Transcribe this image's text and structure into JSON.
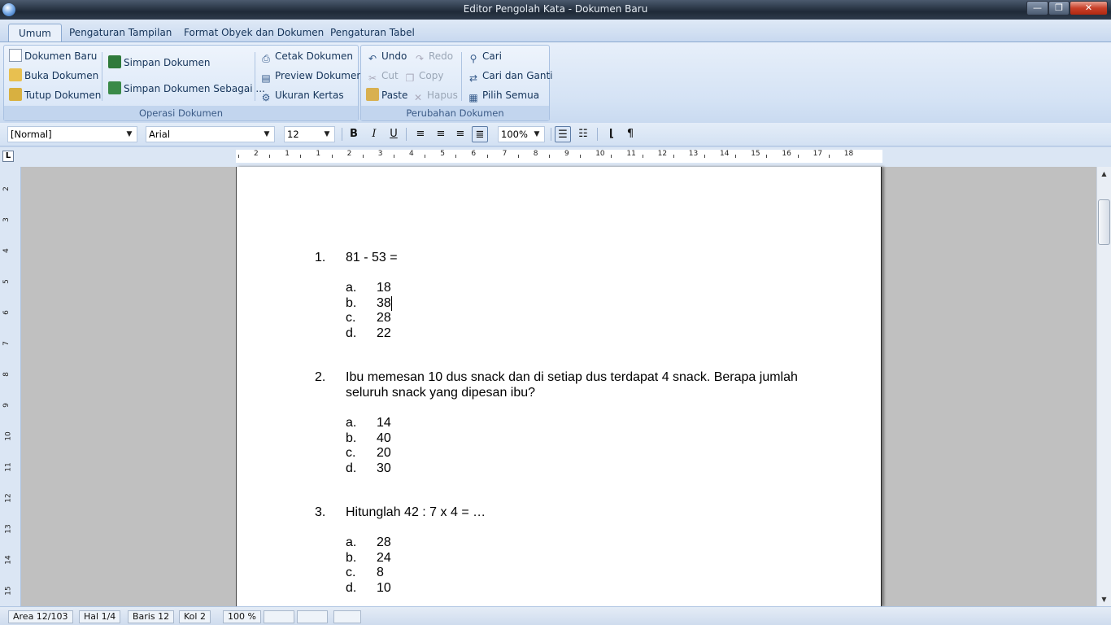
{
  "window": {
    "title": "Editor Pengolah Kata - Dokumen Baru",
    "min": "—",
    "max": "❐",
    "close": "✕"
  },
  "tabs": [
    "Umum",
    "Pengaturan Tampilan",
    "Format Obyek dan Dokumen",
    "Pengaturan Tabel"
  ],
  "ribbon": {
    "operasi": {
      "label": "Operasi Dokumen",
      "dokumen_baru": "Dokumen Baru",
      "buka": "Buka Dokumen",
      "tutup": "Tutup Dokumen",
      "simpan": "Simpan Dokumen",
      "simpan_sebagai": "Simpan Dokumen Sebagai ...",
      "cetak": "Cetak Dokumen",
      "preview": "Preview Dokumen",
      "ukuran": "Ukuran Kertas"
    },
    "perubahan": {
      "label": "Perubahan Dokumen",
      "undo": "Undo",
      "redo": "Redo",
      "cut": "Cut",
      "copy": "Copy",
      "paste": "Paste",
      "hapus": "Hapus",
      "cari": "Cari",
      "cari_ganti": "Cari dan Ganti",
      "pilih_semua": "Pilih Semua"
    }
  },
  "format": {
    "style": "[Normal]",
    "font": "Arial",
    "size": "12",
    "zoom": "100%",
    "bold": "B",
    "italic": "I",
    "underline": "U",
    "pilcrow": "¶"
  },
  "ruler": {
    "corner": "L",
    "numbers": [
      "2",
      "1",
      "1",
      "2",
      "3",
      "4",
      "5",
      "6",
      "7",
      "8",
      "9",
      "10",
      "11",
      "12",
      "13",
      "14",
      "15",
      "16",
      "17",
      "18"
    ]
  },
  "vruler": {
    "numbers": [
      "2",
      "3",
      "4",
      "5",
      "6",
      "7",
      "8",
      "9",
      "10",
      "11",
      "12",
      "13",
      "14",
      "15"
    ]
  },
  "document": {
    "questions": [
      {
        "number": "1.",
        "lines": [
          "81 - 53 ="
        ],
        "options": [
          [
            "a.",
            "18"
          ],
          [
            "b.",
            "38"
          ],
          [
            "c.",
            "28"
          ],
          [
            "d.",
            "22"
          ]
        ]
      },
      {
        "number": "2.",
        "lines": [
          "Ibu memesan 10 dus snack dan di setiap dus terdapat 4 snack. Berapa jumlah",
          "seluruh snack yang dipesan ibu?"
        ],
        "options": [
          [
            "a.",
            "14"
          ],
          [
            "b.",
            "40"
          ],
          [
            "c.",
            "20"
          ],
          [
            "d.",
            "30"
          ]
        ]
      },
      {
        "number": "3.",
        "lines": [
          "Hitunglah 42 : 7 x 4 = …"
        ],
        "options": [
          [
            "a.",
            "28"
          ],
          [
            "b.",
            "24"
          ],
          [
            "c.",
            "8"
          ],
          [
            "d.",
            "10"
          ]
        ]
      }
    ]
  },
  "status": {
    "area": "Area 12/103",
    "hal": "Hal 1/4",
    "baris": "Baris 12",
    "kol": "Kol 2",
    "zoom": "100 %"
  },
  "colors": {
    "ribbon_text": "#15345a",
    "group_label": "#3a5a86",
    "titlebar": "#1f2a38"
  }
}
